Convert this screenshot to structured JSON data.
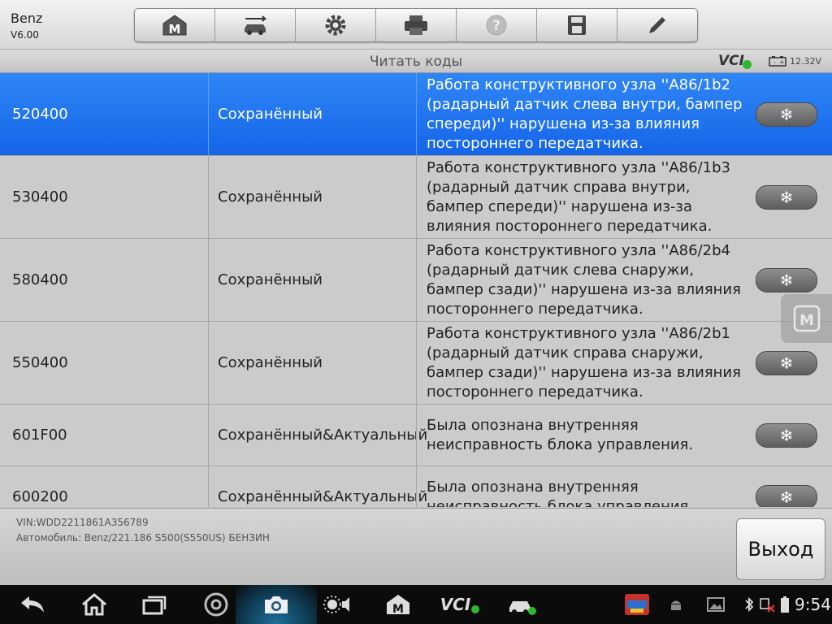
{
  "app": {
    "name": "Benz",
    "version": "V6.00"
  },
  "toolbar": {
    "buttons": [
      {
        "icon": "home-m-icon"
      },
      {
        "icon": "car-switch-icon"
      },
      {
        "icon": "gear-icon"
      },
      {
        "icon": "printer-icon"
      },
      {
        "icon": "help-icon"
      },
      {
        "icon": "save-icon"
      },
      {
        "icon": "pencil-icon"
      }
    ]
  },
  "header": {
    "title": "Читать коды",
    "vci_label": "VCI",
    "voltage": "12.32V"
  },
  "codes": [
    {
      "code": "520400",
      "status": "Сохранённый",
      "description": "Работа конструктивного узла ''A86/1b2 (радарный датчик слева внутри, бампер спереди)'' нарушена из-за влияния постороннего передатчика.",
      "selected": true
    },
    {
      "code": "530400",
      "status": "Сохранённый",
      "description": "Работа конструктивного узла ''A86/1b3 (радарный датчик справа внутри, бампер спереди)'' нарушена из-за влияния постороннего передатчика."
    },
    {
      "code": "580400",
      "status": "Сохранённый",
      "description": "Работа конструктивного узла ''A86/2b4 (радарный датчик слева снаружи, бампер сзади)'' нарушена из-за влияния постороннего передатчика."
    },
    {
      "code": "550400",
      "status": "Сохранённый",
      "description": "Работа конструктивного узла ''A86/2b1 (радарный датчик справа снаружи, бампер сзади)'' нарушена из-за влияния постороннего передатчика."
    },
    {
      "code": "601F00",
      "status": "Сохранённый&Актуальный",
      "description": "Была опознана внутренняя неисправность блока управления."
    },
    {
      "code": "600200",
      "status": "Сохранённый&Актуальный",
      "description": "Была опознана внутренняя неисправность блока управления."
    }
  ],
  "footer": {
    "vin": "VIN:WDD2211861A356789",
    "vehicle": "Автомобиль: Benz/221.186 S500(S550US) БЕНЗИН",
    "exit_label": "Выход"
  },
  "system_bar": {
    "time": "9:54",
    "vci_label": "VCI"
  },
  "colors": {
    "selected_row": "#1e6ff0",
    "row_bg": "#cbcbcb",
    "status_ok": "#2eb82e"
  }
}
